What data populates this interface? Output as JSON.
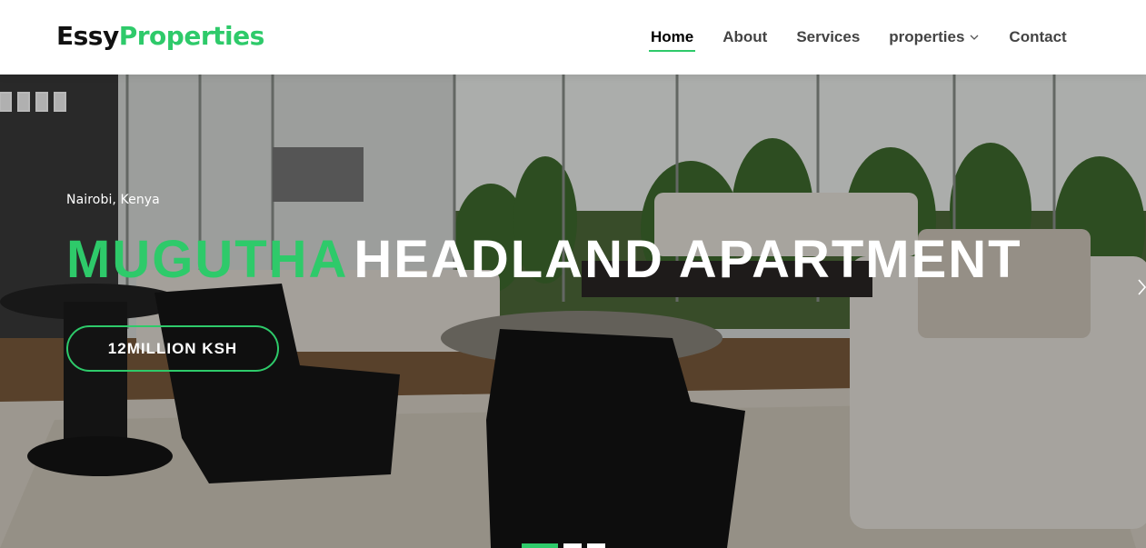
{
  "header": {
    "logo_part1": "Essy",
    "logo_part2": "Properties",
    "nav": [
      "Home",
      "About",
      "Services",
      "properties",
      "Contact"
    ],
    "active_nav": "Home"
  },
  "hero": {
    "location": "Nairobi, Kenya",
    "title_highlight": "MUGUTHA",
    "title_rest": "HEADLAND APARTMENT",
    "price": "12MILLION KSH",
    "carousel": {
      "slides": 3,
      "active_slide": 1
    }
  },
  "colors": {
    "accent": "#2eca6a",
    "text_dark": "#111111",
    "nav_text": "#444444"
  },
  "icons": {
    "dropdown": "chevron-down-icon",
    "next": "chevron-right-icon"
  }
}
